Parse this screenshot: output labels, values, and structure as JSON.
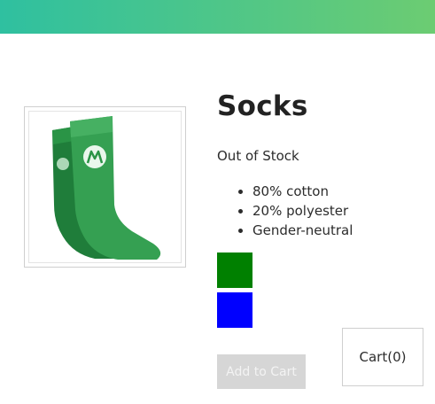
{
  "header": {
    "banner_colors": [
      "#2fc0a0",
      "#6ccc72"
    ]
  },
  "product": {
    "image_icon": "green-socks-image",
    "title": "Socks",
    "stock_status": "Out of Stock",
    "features": [
      "80% cotton",
      "20% polyester",
      "Gender-neutral"
    ],
    "variants": [
      {
        "name": "green",
        "color": "#008000"
      },
      {
        "name": "blue",
        "color": "#0000ff"
      }
    ],
    "add_to_cart_label": "Add to Cart",
    "add_to_cart_enabled": false
  },
  "cart": {
    "label": "Cart(0)"
  }
}
